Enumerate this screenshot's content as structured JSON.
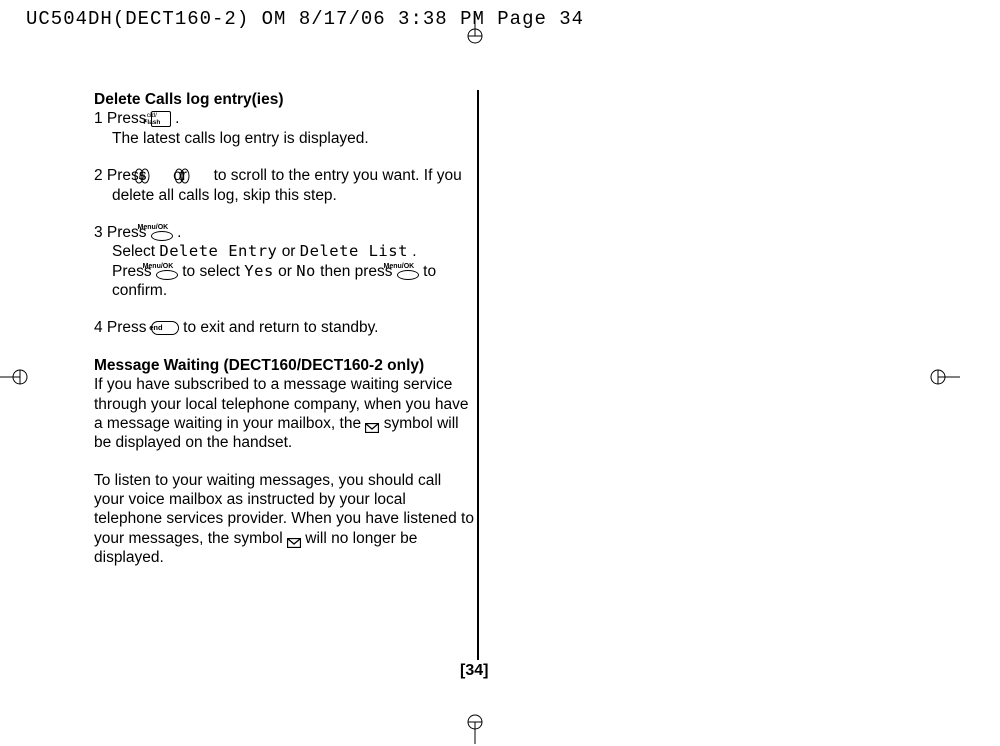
{
  "header": "UC504DH(DECT160-2) OM  8/17/06  3:38 PM  Page 34",
  "section1_heading": "Delete Calls log entry(ies)",
  "step1_a": "1  Press ",
  "cid_flash_l1": "cid/",
  "cid_flash_l2": "Flash",
  "step1_b": " .",
  "step1_line2": "The latest calls log entry is displayed.",
  "step2_a": "2  Press ",
  "step2_b": " or ",
  "step2_c": " to scroll to the entry you want. If you delete all calls log, skip this step.",
  "step3_a": "3  Press ",
  "menu_label": "Menu/OK",
  "step3_b": " .",
  "step3_line2a": "Select ",
  "delete_entry": "Delete Entry",
  "step3_or": " or ",
  "delete_list": "Delete List",
  "step3_line2b": ".",
  "step3_line3a": "Press ",
  "step3_line3b": " to select ",
  "yes": "Yes",
  "step3_line3c": " or ",
  "no": "No",
  "step3_line3d": " then press ",
  "step3_line3e": " to confirm.",
  "step4_a": "4  Press ",
  "end_label": "end",
  "step4_b": " to exit and return to standby.",
  "section2_heading": "Message Waiting (DECT160/DECT160-2 only)",
  "section2_p1a": "If you have subscribed to a message waiting service through your local telephone company, when you have a message waiting in your mailbox, the ",
  "section2_p1b": " symbol will be displayed on the handset.",
  "section2_p2a": "To listen to your waiting messages, you should call your voice mailbox as instructed by your local telephone services provider. When you have listened to your messages, the symbol ",
  "section2_p2b": " will no longer be displayed.",
  "page_number": "[34]"
}
